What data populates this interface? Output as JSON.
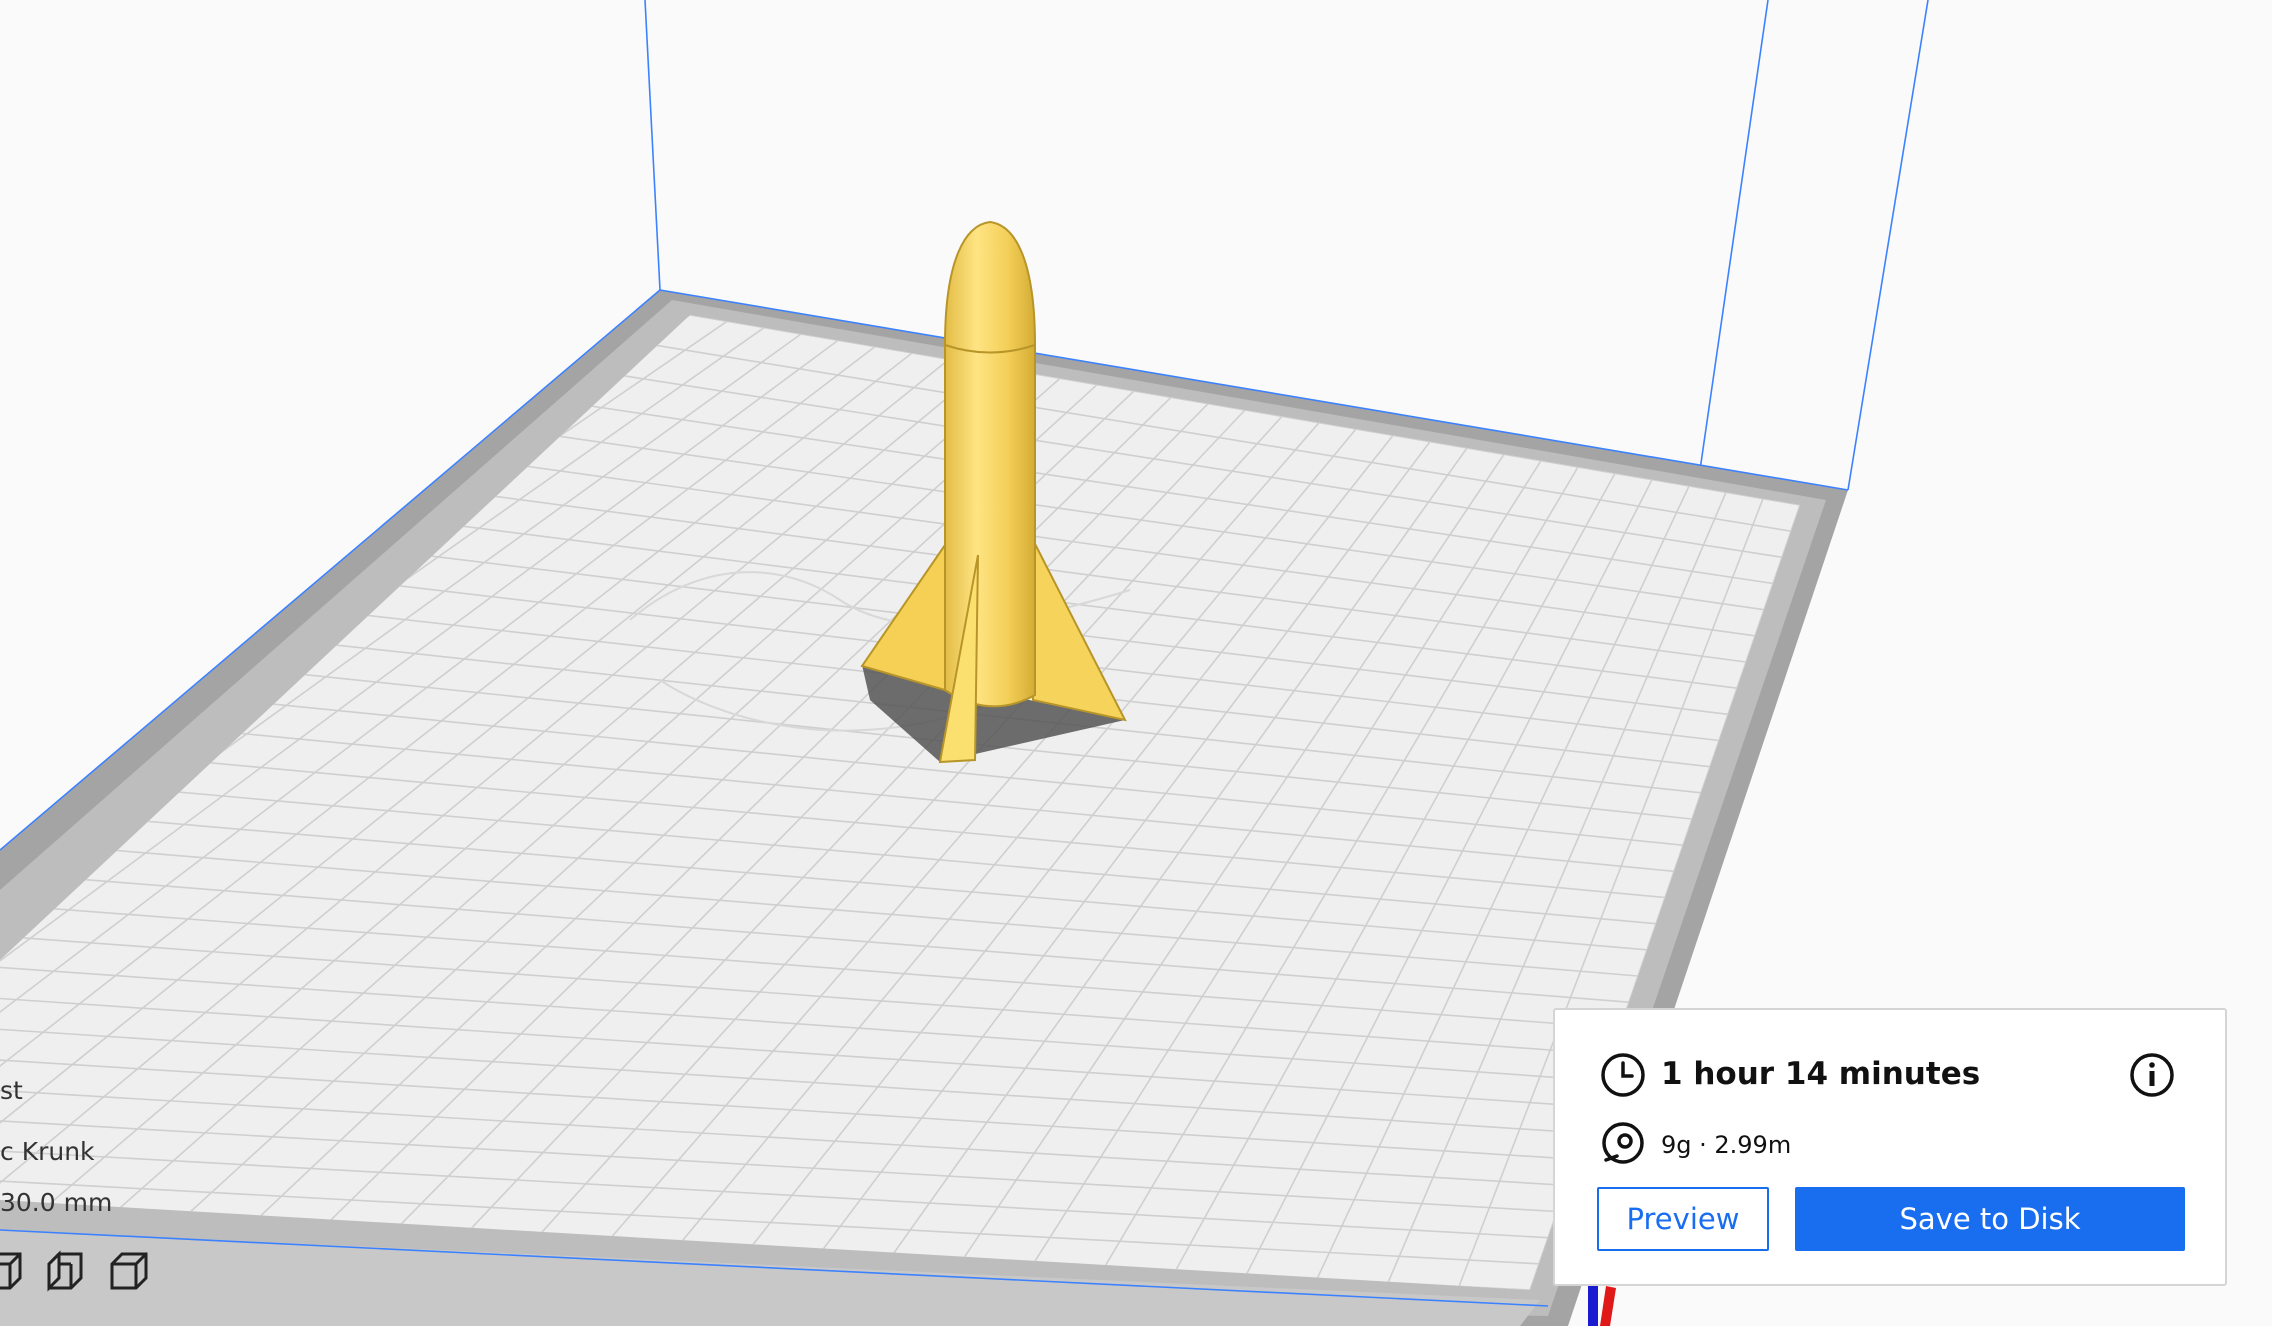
{
  "object_info": {
    "name_fragment": "st",
    "author_fragment": "c Krunk",
    "dimension_fragment": "30.0 mm"
  },
  "view_buttons": [
    {
      "icon": "view-side-cube-icon"
    },
    {
      "icon": "view-left-cube-icon"
    },
    {
      "icon": "view-right-cube-icon"
    }
  ],
  "print_panel": {
    "print_time": "1 hour 14 minutes",
    "material": "9g · 2.99m",
    "preview_label": "Preview",
    "save_label": "Save to Disk",
    "icons": [
      "clock-icon",
      "spool-icon",
      "info-icon"
    ]
  },
  "colors": {
    "model": "#f8d85e",
    "accent": "#196ef0",
    "build_volume_outline": "#3c82ff",
    "axis_x": "#e01818",
    "axis_z": "#1a1ad0"
  }
}
